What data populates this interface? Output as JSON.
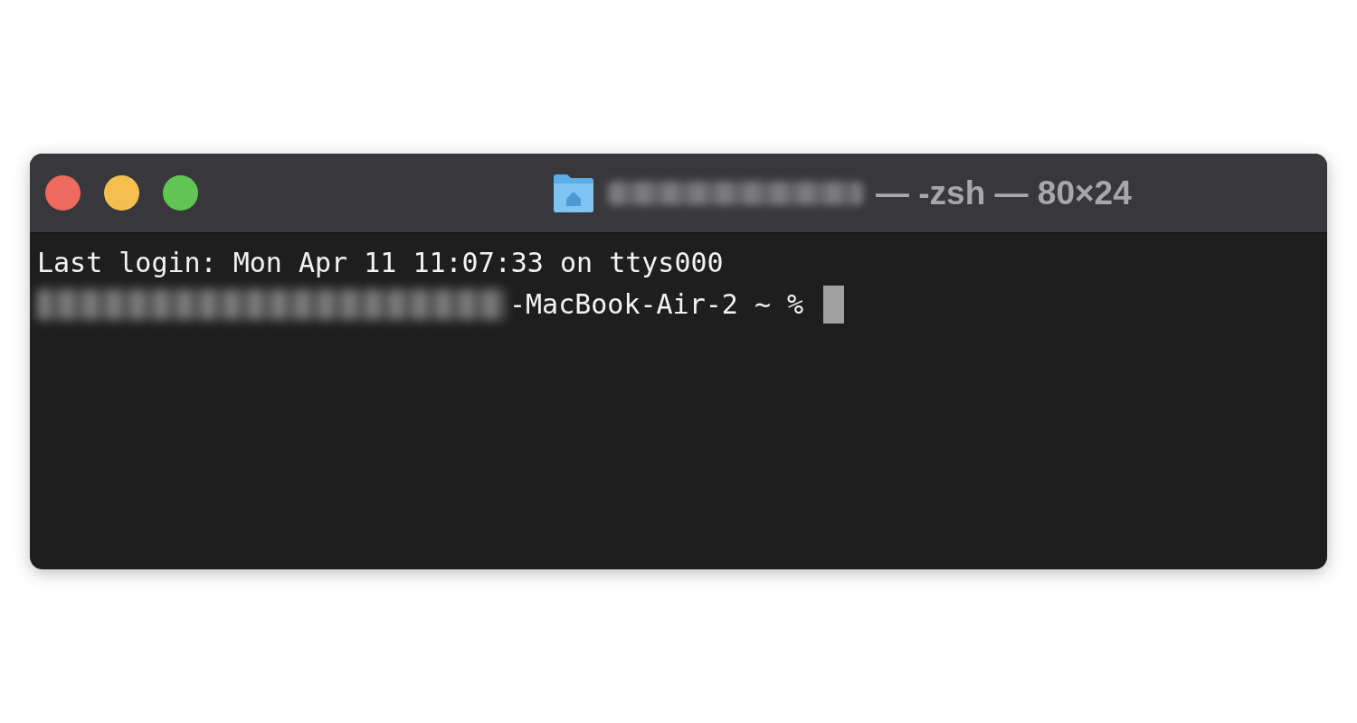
{
  "window": {
    "title": "— -zsh — 80×24"
  },
  "terminal": {
    "lines": [
      {
        "kind": "output",
        "text": "Last login: Mon Apr 11 11:07:33 on ttys000"
      },
      {
        "kind": "prompt",
        "text": "-MacBook-Air-2 ~ %"
      }
    ]
  }
}
